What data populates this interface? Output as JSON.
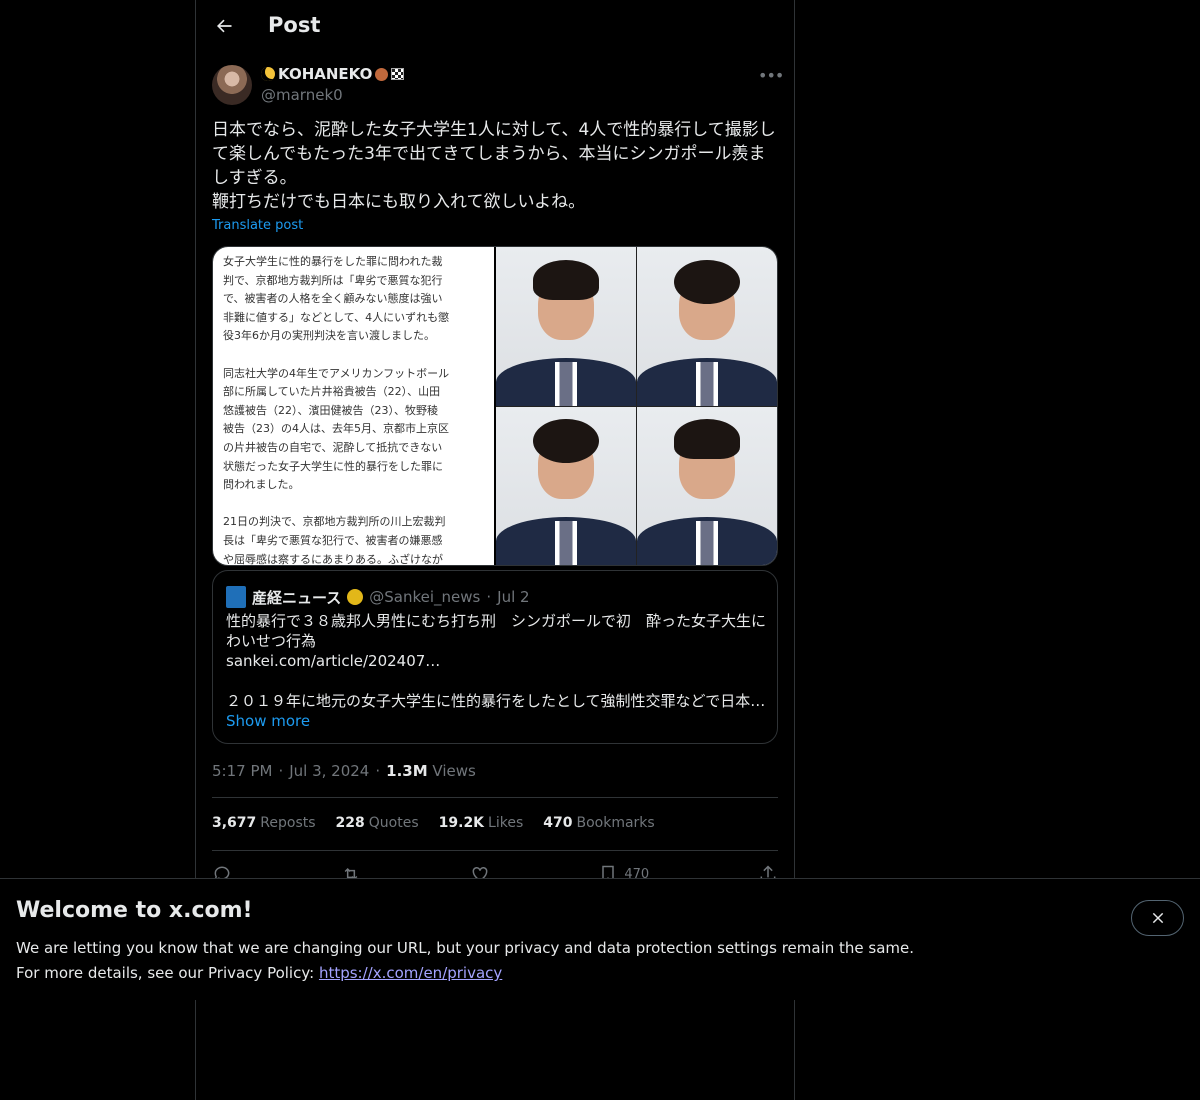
{
  "header": {
    "title": "Post"
  },
  "post": {
    "display_name": "KOHANEKO",
    "handle": "@marnek0",
    "text": "日本でなら、泥酔した女子大学生1人に対して、4人で性的暴行して撮影し\nて楽しんでもたった3年で出てきてしまうから、本当にシンガポール羨ま\nしすぎる。\n鞭打ちだけでも日本にも取り入れて欲しいよね。",
    "translate_label": "Translate post",
    "media_text": "女子大学生に性的暴行をした罪に問われた裁\n判で、京都地方裁判所は「卑劣で悪質な犯行\nで、被害者の人格を全く顧みない態度は強い\n非難に値する」などとして、4人にいずれも懲\n役3年6か月の実刑判決を言い渡しました。\n\n同志社大学の4年生でアメリカンフットボール\n部に所属していた片井裕貴被告（22）、山田\n悠護被告（22）、濱田健被告（23）、牧野稜\n被告（23）の4人は、去年5月、京都市上京区\nの片井被告の自宅で、泥酔して抵抗できない\n状態だった女子大学生に性的暴行をした罪に\n問われました。\n\n21日の判決で、京都地方裁判所の川上宏裁判\n長は「卑劣で悪質な犯行で、被害者の嫌悪感\nや屈辱感は察するにあまりある。ふざけなが",
    "time": "5:17 PM",
    "date": "Jul 3, 2024",
    "views_count": "1.3M",
    "views_label": "Views"
  },
  "quote": {
    "name": "産経ニュース",
    "handle": "@Sankei_news",
    "date": "Jul 2",
    "line1": "性的暴行で３８歳邦人男性にむち打ち刑　シンガポールで初　酔った女子大生に",
    "line2": "わいせつ行為",
    "link": "sankei.com/article/202407…",
    "line3": "２０１９年に地元の女子大学生に性的暴行をしたとして強制性交罪などで日本…",
    "show_more": "Show more"
  },
  "stats": {
    "reposts_count": "3,677",
    "reposts_label": "Reposts",
    "quotes_count": "228",
    "quotes_label": "Quotes",
    "likes_count": "19.2K",
    "likes_label": "Likes",
    "bookmarks_count": "470",
    "bookmarks_label": "Bookmarks"
  },
  "actions": {
    "bookmark_count": "470"
  },
  "banner": {
    "title": "Welcome to x.com!",
    "line1": "We are letting you know that we are changing our URL, but your privacy and data protection settings remain the same.",
    "line2_prefix": "For more details, see our Privacy Policy: ",
    "link": "https://x.com/en/privacy"
  },
  "icons": [
    "back-arrow-icon",
    "more-icon",
    "verified-badge-icon",
    "reply-icon",
    "repost-icon",
    "like-icon",
    "bookmark-icon",
    "share-icon",
    "close-icon"
  ],
  "colors": {
    "accent": "#1d9bf0",
    "background": "#000000",
    "muted": "#71767b",
    "verified": "#e2b719"
  }
}
